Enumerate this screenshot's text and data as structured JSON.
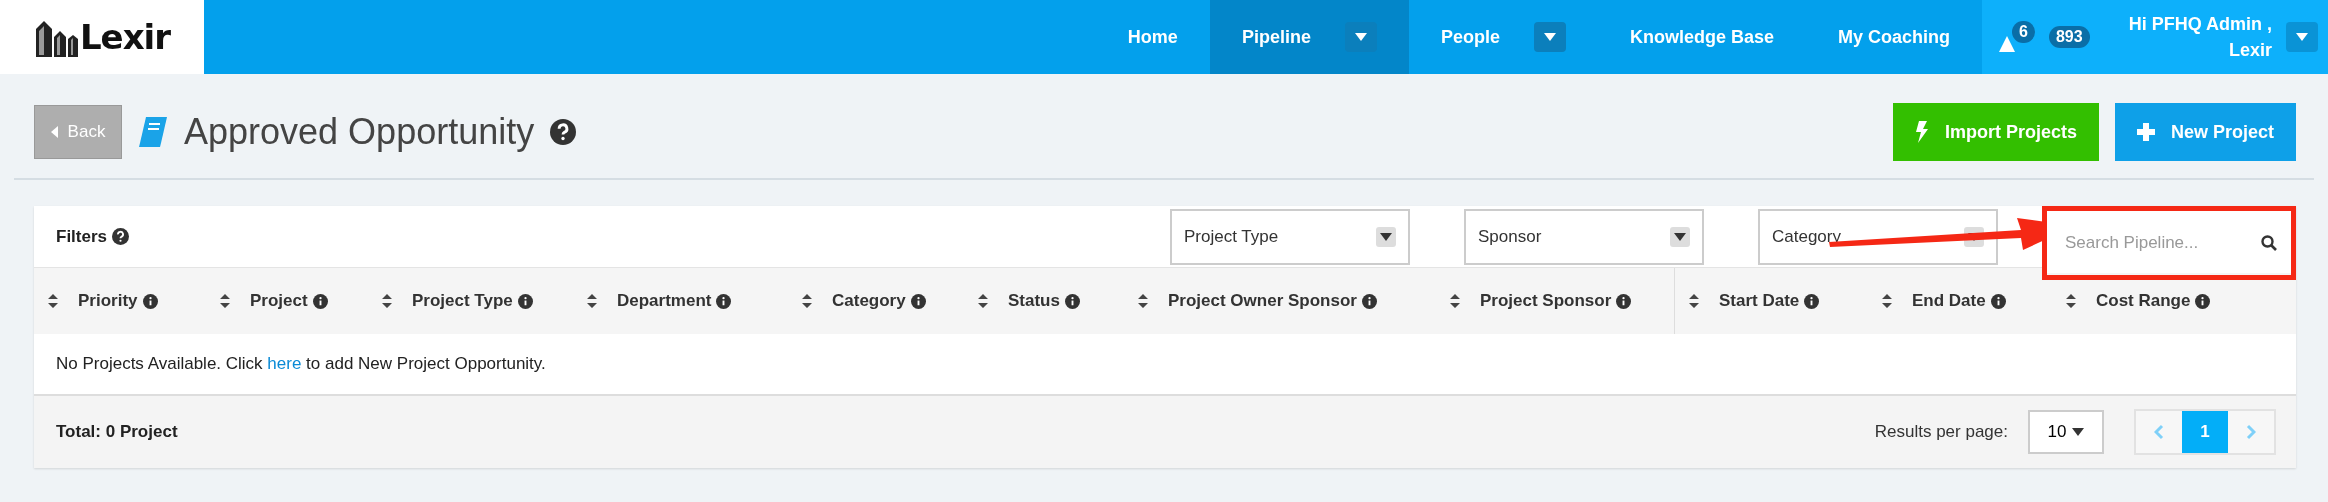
{
  "nav": {
    "logo_text": "Lexir",
    "items": [
      {
        "label": "Home",
        "selected": false,
        "has_menu": false
      },
      {
        "label": "Pipeline",
        "selected": true,
        "has_menu": true
      },
      {
        "label": "People",
        "selected": false,
        "has_menu": true
      },
      {
        "label": "Knowledge Base",
        "selected": false,
        "has_menu": false
      },
      {
        "label": "My Coaching",
        "selected": false,
        "has_menu": false
      }
    ],
    "alerts_count": "6",
    "notifications_count": "893",
    "user_greeting": "Hi PFHQ Admin ,",
    "user_org": "Lexir"
  },
  "header": {
    "back": "Back",
    "title": "Approved Opportunity",
    "actions": [
      {
        "label": "Import Projects",
        "kind": "import"
      },
      {
        "label": "New Project",
        "kind": "new"
      }
    ]
  },
  "filters": {
    "label": "Filters",
    "selects": [
      "Project Type",
      "Sponsor",
      "Category"
    ],
    "search_placeholder": "Search Pipeline..."
  },
  "annotation": {
    "kind": "arrow-to-search"
  },
  "table": {
    "columns": [
      "Priority",
      "Project",
      "Project Type",
      "Department",
      "Category",
      "Status",
      "Project Owner Sponsor",
      "Project Sponsor",
      "Start Date",
      "End Date",
      "Cost Range"
    ],
    "empty_before": "No Projects Available. Click",
    "empty_link": "here",
    "empty_after": "to add New Project Opportunity."
  },
  "footer": {
    "total": "Total: 0 Project",
    "per_page_label": "Results per page:",
    "per_page": "10",
    "pages": [
      {
        "label": "1",
        "selected": true
      }
    ]
  }
}
